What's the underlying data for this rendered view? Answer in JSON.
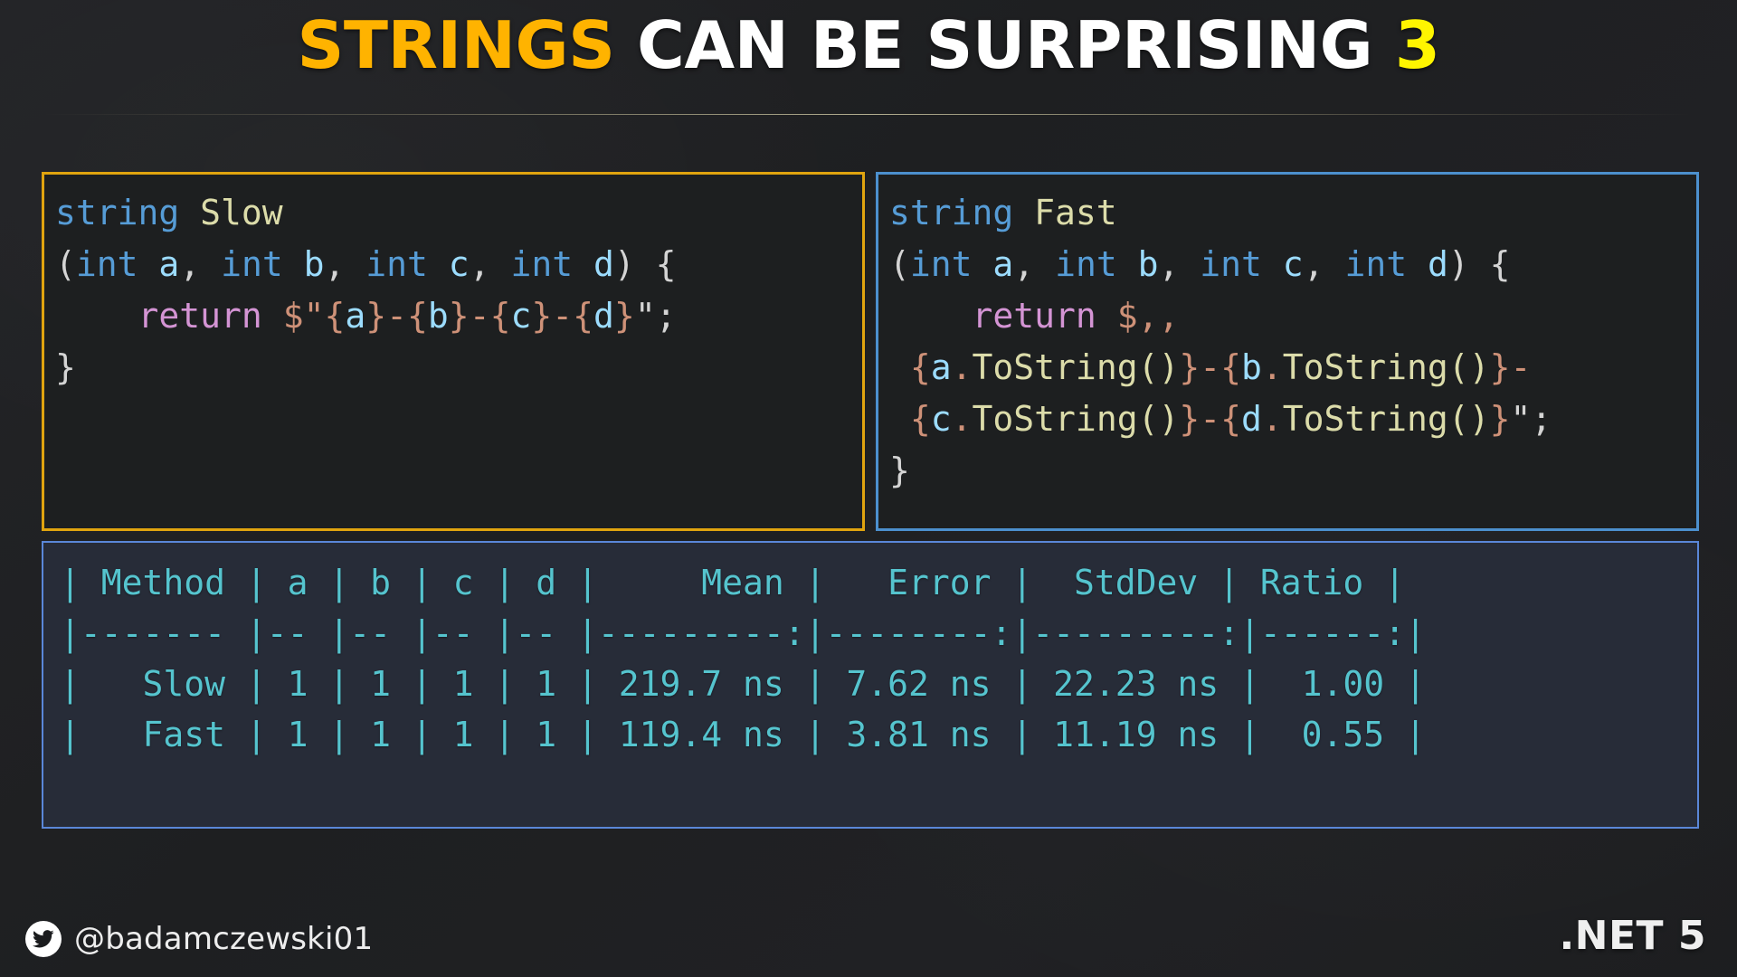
{
  "title": {
    "highlight": "STRINGS",
    "middle": " CAN BE SURPRISING ",
    "number": "3",
    "highlight_color": "#FFB300",
    "middle_color": "#FFFFFF",
    "number_color": "#FFF500"
  },
  "code_slow": {
    "border_color": "#E0A40F",
    "lines": [
      "string Slow",
      "(int a, int b, int c, int d) {",
      "    return $\"{a}-{b}-{c}-{d}\";",
      "}"
    ],
    "tokens": {
      "keyword_string": "string",
      "method_name": "Slow",
      "keyword_int": "int",
      "params": [
        "a",
        "b",
        "c",
        "d"
      ],
      "keyword_return": "return",
      "interpolation_prefix": "$\"",
      "separator": "-",
      "terminator": "\";"
    }
  },
  "code_fast": {
    "border_color": "#4C90CE",
    "lines": [
      "string Fast",
      "(int a, int b, int c, int d) {",
      "    return $,,",
      " {a.ToString()}-{b.ToString()}-",
      " {c.ToString()}-{d.ToString()}\";",
      "}"
    ],
    "tokens": {
      "keyword_string": "string",
      "method_name": "Fast",
      "keyword_int": "int",
      "params": [
        "a",
        "b",
        "c",
        "d"
      ],
      "keyword_return": "return",
      "interpolation_prefix": "$,,",
      "method_call": "ToString()",
      "separator": "-",
      "terminator": "\";"
    }
  },
  "results": {
    "border_color": "#5A87D8",
    "text_color": "#55C4CE",
    "background": "#272c38",
    "headers": [
      "Method",
      "a",
      "b",
      "c",
      "d",
      "Mean",
      "Error",
      "StdDev",
      "Ratio"
    ],
    "separator_row": "|------- |-- |-- |-- |-- |---------:|--------:|---------:|------:|",
    "rows": [
      {
        "Method": "Slow",
        "a": "1",
        "b": "1",
        "c": "1",
        "d": "1",
        "Mean": "219.7 ns",
        "Error": "7.62 ns",
        "StdDev": "22.23 ns",
        "Ratio": "1.00"
      },
      {
        "Method": "Fast",
        "a": "1",
        "b": "1",
        "c": "1",
        "d": "1",
        "Mean": "119.4 ns",
        "Error": "3.81 ns",
        "StdDev": "11.19 ns",
        "Ratio": "0.55"
      }
    ],
    "raw": "| Method | a | b | c | d |     Mean |   Error |  StdDev | Ratio |\n|------- |-- |-- |-- |-- |---------:|--------:|---------:|------:|\n|   Slow | 1 | 1 | 1 | 1 | 219.7 ns | 7.62 ns | 22.23 ns |  1.00 |\n|   Fast | 1 | 1 | 1 | 1 | 119.4 ns | 3.81 ns | 11.19 ns |  0.55 |"
  },
  "footer": {
    "twitter_icon": "twitter-bird-icon",
    "handle": "@badamczewski01",
    "platform": ".NET 5"
  }
}
